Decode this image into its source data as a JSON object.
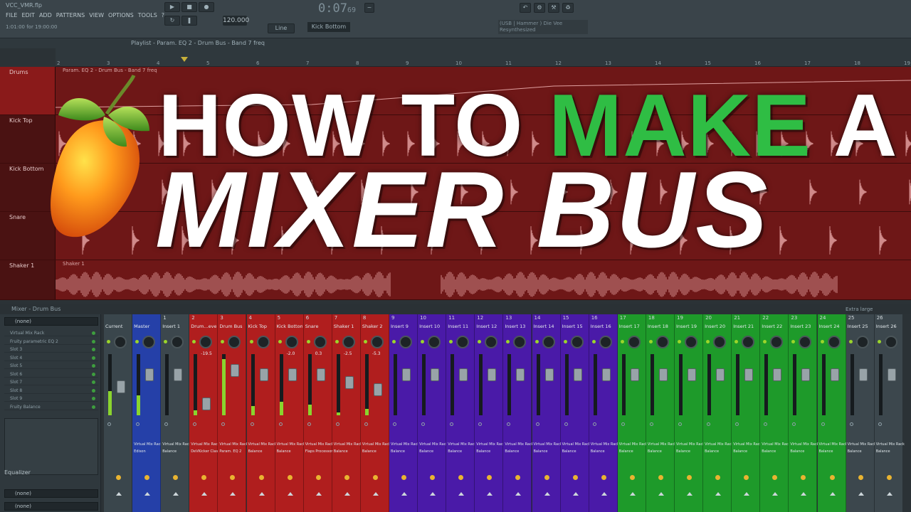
{
  "topbar": {
    "project_title": "VCC_VMR.flp",
    "menus": [
      "FILE",
      "EDIT",
      "ADD",
      "PATTERNS",
      "VIEW",
      "OPTIONS",
      "TOOLS",
      "?"
    ],
    "status": "1:01:00 for 19:00:00",
    "time_main": "0:07",
    "time_sub": "69",
    "bpm": "120.000",
    "line_mode": "Line",
    "pattern": "Kick Bottom",
    "hint_line1": "(USB | Hammer ) Die Vee",
    "hint_line2": "Resynthesized"
  },
  "playlist": {
    "title": "Playlist - Param. EQ 2 - Drum Bus - Band 7 freq",
    "ruler_numbers": [
      "2",
      "3",
      "4",
      "5",
      "6",
      "7",
      "8",
      "9",
      "10",
      "11",
      "12",
      "13",
      "14",
      "15",
      "16",
      "17",
      "18",
      "19"
    ],
    "tracks": [
      {
        "name": "Drums",
        "clip": "Param. EQ 2 - Drum Bus - Band 7 freq"
      },
      {
        "name": "Kick Top",
        "clip": ""
      },
      {
        "name": "Kick Bottom",
        "clip": ""
      },
      {
        "name": "Snare",
        "clip": ""
      },
      {
        "name": "Shaker 1",
        "clip": "Shaker 1"
      }
    ]
  },
  "mixer": {
    "title": "Mixer - Drum Bus",
    "extra": "Extra large",
    "preset_top": "(none)",
    "slots": [
      "Virtual Mix Rack",
      "Fruity parametric EQ 2",
      "Slot 3",
      "Slot 4",
      "Slot 5",
      "Slot 6",
      "Slot 7",
      "Slot 8",
      "Slot 9",
      "Fruity Balance"
    ],
    "eq_label": "Equalizer",
    "preset_bottom_1": "(none)",
    "preset_bottom_2": "(none)",
    "strips": [
      {
        "num": "",
        "name": "Current",
        "color": "#3a464c",
        "fx1": "",
        "fx2": "",
        "meter": 0.4,
        "fader": 0.55,
        "db": ""
      },
      {
        "num": "",
        "name": "Master",
        "color": "#2540a8",
        "fx1": "Virtual Mix Rack",
        "fx2": "Edison",
        "meter": 0.32,
        "fader": 0.3,
        "db": ""
      },
      {
        "num": "1",
        "name": "Insert 1",
        "color": "#3c474d",
        "fx1": "Virtual Mix Rack",
        "fx2": "Balance",
        "meter": 0,
        "fader": 0.3,
        "db": ""
      },
      {
        "num": "2",
        "name": "Drum...everb",
        "color": "#b01e1e",
        "fx1": "Virtual Mix Rack",
        "fx2": "DeVKicker Classic",
        "meter": 0.08,
        "fader": 0.9,
        "db": "-19.5"
      },
      {
        "num": "3",
        "name": "Drum Bus",
        "color": "#b01e1e",
        "fx1": "Virtual Mix Rack",
        "fx2": "Param. EQ 2",
        "meter": 0.92,
        "fader": 0.2,
        "db": ""
      },
      {
        "num": "4",
        "name": "Kick Top",
        "color": "#b01e1e",
        "fx1": "Virtual Mix Rack",
        "fx2": "Balance",
        "meter": 0.15,
        "fader": 0.3,
        "db": ""
      },
      {
        "num": "5",
        "name": "Kick Bottom",
        "color": "#b01e1e",
        "fx1": "Virtual Mix Rack",
        "fx2": "Balance",
        "meter": 0.22,
        "fader": 0.3,
        "db": "-2.0"
      },
      {
        "num": "6",
        "name": "Snare",
        "color": "#b01e1e",
        "fx1": "Virtual Mix Rack",
        "fx2": "Flaps Processor",
        "meter": 0.18,
        "fader": 0.3,
        "db": "0.3"
      },
      {
        "num": "7",
        "name": "Shaker 1",
        "color": "#b01e1e",
        "fx1": "Virtual Mix Rack",
        "fx2": "Balance",
        "meter": 0.05,
        "fader": 0.45,
        "db": "-2.5"
      },
      {
        "num": "8",
        "name": "Shaker 2",
        "color": "#b01e1e",
        "fx1": "Virtual Mix Rack",
        "fx2": "Balance",
        "meter": 0.1,
        "fader": 0.6,
        "db": "-5.3"
      },
      {
        "num": "9",
        "name": "Insert 9",
        "color": "#4a1aa8",
        "fx1": "Virtual Mix Rack",
        "fx2": "Balance",
        "meter": 0,
        "fader": 0.3,
        "db": ""
      },
      {
        "num": "10",
        "name": "Insert 10",
        "color": "#4a1aa8",
        "fx1": "Virtual Mix Rack",
        "fx2": "Balance",
        "meter": 0,
        "fader": 0.3,
        "db": ""
      },
      {
        "num": "11",
        "name": "Insert 11",
        "color": "#4a1aa8",
        "fx1": "Virtual Mix Rack",
        "fx2": "Balance",
        "meter": 0,
        "fader": 0.3,
        "db": ""
      },
      {
        "num": "12",
        "name": "Insert 12",
        "color": "#4a1aa8",
        "fx1": "Virtual Mix Rack",
        "fx2": "Balance",
        "meter": 0,
        "fader": 0.3,
        "db": ""
      },
      {
        "num": "13",
        "name": "Insert 13",
        "color": "#4a1aa8",
        "fx1": "Virtual Mix Rack",
        "fx2": "Balance",
        "meter": 0,
        "fader": 0.3,
        "db": ""
      },
      {
        "num": "14",
        "name": "Insert 14",
        "color": "#4a1aa8",
        "fx1": "Virtual Mix Rack",
        "fx2": "Balance",
        "meter": 0,
        "fader": 0.3,
        "db": ""
      },
      {
        "num": "15",
        "name": "Insert 15",
        "color": "#4a1aa8",
        "fx1": "Virtual Mix Rack",
        "fx2": "Balance",
        "meter": 0,
        "fader": 0.3,
        "db": ""
      },
      {
        "num": "16",
        "name": "Insert 16",
        "color": "#4a1aa8",
        "fx1": "Virtual Mix Rack",
        "fx2": "Balance",
        "meter": 0,
        "fader": 0.3,
        "db": ""
      },
      {
        "num": "17",
        "name": "Insert 17",
        "color": "#1e9a2a",
        "fx1": "Virtual Mix Rack",
        "fx2": "Balance",
        "meter": 0,
        "fader": 0.3,
        "db": ""
      },
      {
        "num": "18",
        "name": "Insert 18",
        "color": "#1e9a2a",
        "fx1": "Virtual Mix Rack",
        "fx2": "Balance",
        "meter": 0,
        "fader": 0.3,
        "db": ""
      },
      {
        "num": "19",
        "name": "Insert 19",
        "color": "#1e9a2a",
        "fx1": "Virtual Mix Rack",
        "fx2": "Balance",
        "meter": 0,
        "fader": 0.3,
        "db": ""
      },
      {
        "num": "20",
        "name": "Insert 20",
        "color": "#1e9a2a",
        "fx1": "Virtual Mix Rack",
        "fx2": "Balance",
        "meter": 0,
        "fader": 0.3,
        "db": ""
      },
      {
        "num": "21",
        "name": "Insert 21",
        "color": "#1e9a2a",
        "fx1": "Virtual Mix Rack",
        "fx2": "Balance",
        "meter": 0,
        "fader": 0.3,
        "db": ""
      },
      {
        "num": "22",
        "name": "Insert 22",
        "color": "#1e9a2a",
        "fx1": "Virtual Mix Rack",
        "fx2": "Balance",
        "meter": 0,
        "fader": 0.3,
        "db": ""
      },
      {
        "num": "23",
        "name": "Insert 23",
        "color": "#1e9a2a",
        "fx1": "Virtual Mix Rack",
        "fx2": "Balance",
        "meter": 0,
        "fader": 0.3,
        "db": ""
      },
      {
        "num": "24",
        "name": "Insert 24",
        "color": "#1e9a2a",
        "fx1": "Virtual Mix Rack",
        "fx2": "Balance",
        "meter": 0,
        "fader": 0.3,
        "db": ""
      },
      {
        "num": "25",
        "name": "Insert 25",
        "color": "#3c474d",
        "fx1": "Virtual Mix Rack",
        "fx2": "Balance",
        "meter": 0,
        "fader": 0.3,
        "db": ""
      },
      {
        "num": "26",
        "name": "Insert 26",
        "color": "#3c474d",
        "fx1": "Virtual Mix Rack",
        "fx2": "Balance",
        "meter": 0,
        "fader": 0.3,
        "db": ""
      }
    ]
  },
  "overlay": {
    "line1_pre": "HOW TO ",
    "line1_accent": "MAKE",
    "line1_post": " A",
    "line2": "MIXER BUS",
    "accent_color": "#2fbd44",
    "logo": "fl-studio-fruit-logo"
  }
}
